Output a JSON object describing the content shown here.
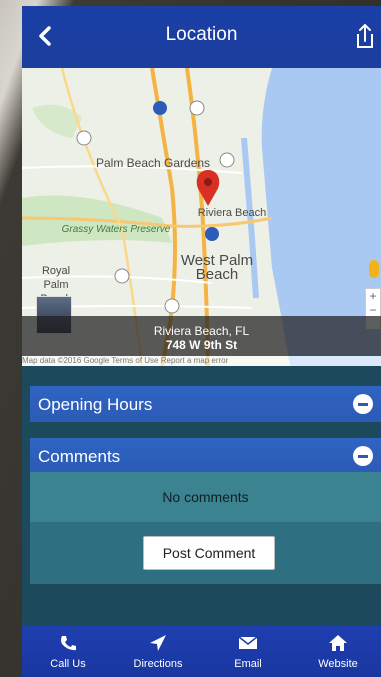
{
  "header": {
    "title": "Location",
    "back_icon": "chevron-left-icon",
    "share_icon": "share-icon"
  },
  "map": {
    "labels": {
      "palm_beach_gardens": "Palm Beach Gardens",
      "riviera_beach": "Riviera Beach",
      "grassy_waters": "Grassy Waters Preserve",
      "west_palm_beach": "West Palm Beach",
      "royal_palm_beach": "Royal Palm Beach"
    },
    "caption_city": "Riviera Beach, FL",
    "caption_address": "748 W 9th St",
    "attribution": "Map data ©2016 Google   Terms of Use   Report a map error",
    "zoom_plus": "+",
    "zoom_minus": "−",
    "pin_color": "#d93025"
  },
  "panels": {
    "opening_hours": "Opening Hours",
    "comments": "Comments",
    "no_comments": "No comments",
    "post_comment": "Post Comment"
  },
  "nav": {
    "call_us": "Call Us",
    "directions": "Directions",
    "email": "Email",
    "website": "Website"
  },
  "colors": {
    "header": "#1c3e9c",
    "panel": "#2b5bb5",
    "content_bg": "#1c4a5c"
  }
}
